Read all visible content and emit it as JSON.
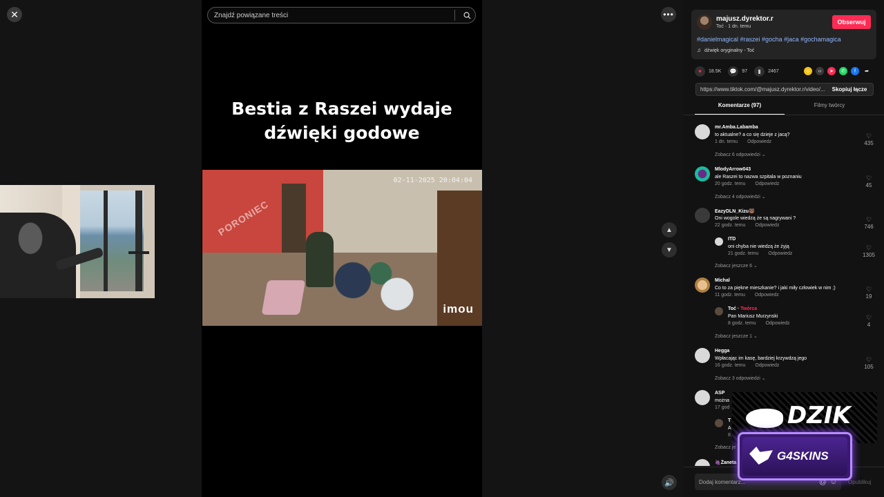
{
  "player": {
    "search_placeholder": "Znajdź powiązane treści",
    "caption": "Bestia z Raszei wydaje\ndźwięki godowe",
    "cctv_timestamp": "02-11-2025 20:04:04",
    "cctv_watermark": "PORONIEC",
    "cctv_logo": "imou"
  },
  "post": {
    "author": "majusz.dyrektor.r",
    "meta": "Toć · 1 dn. temu",
    "follow_label": "Obserwuj",
    "tags": "#danielmagical #raszei #gocha #jaca #gochamagica",
    "sound": "dźwięk oryginalny - Toć",
    "likes": "18.5K",
    "comments": "97",
    "saves": "2467",
    "link": "https://www.tiktok.com/@majusz.dyrektor.r/video/...",
    "copy_label": "Skopiuj łącze"
  },
  "tabs": {
    "comments": "Komentarze (97)",
    "creator_videos": "Filmy twórcy"
  },
  "comments": [
    {
      "name": "mr.Amba.Labamba",
      "text": "to aktualne? a co się dzieje z jacą?",
      "time": "1 dn. temu",
      "reply": "Odpowiedz",
      "likes": "435",
      "more": "Zobacz 6 odpowiedzi ⌄"
    },
    {
      "name": "MlodyArrow043",
      "text": "ale Raszei to nazwa szpitala w poznaniu",
      "time": "20 godz. temu",
      "reply": "Odpowiedz",
      "likes": "45",
      "more": "Zobacz 4 odpowiedzi ⌄"
    },
    {
      "name": "EazyDLN_Kizu🐻",
      "text": "Oni wogole wiedzą że są nagrywani ?",
      "time": "22 godz. temu",
      "reply": "Odpowiedz",
      "likes": "746"
    },
    {
      "name": "ITD",
      "text": "oni chyba nie wiedzą że żyją",
      "time": "21 godz. temu",
      "reply": "Odpowiedz",
      "likes": "1305",
      "more": "Zobacz jeszcze 6 ⌄"
    },
    {
      "name": "Michal",
      "text": "Co to za piękne mieszkanie? i jaki miły człowiek w nim ;)",
      "time": "11 godz. temu",
      "reply": "Odpowiedz",
      "likes": "19"
    },
    {
      "name": "Toć",
      "creator": "Twórca",
      "text": "Pan Mariusz Murzynski",
      "time": "8 godz. temu",
      "reply": "Odpowiedz",
      "likes": "4",
      "more": "Zobacz jeszcze 1 ⌄"
    },
    {
      "name": "Hegga",
      "text": "Wpłacając im kasę, bardziej krzywdzą jego",
      "time": "16 godz. temu",
      "reply": "Odpowiedz",
      "likes": "105",
      "more": "Zobacz 3 odpowiedzi ⌄"
    },
    {
      "name": "ASP",
      "text": "można",
      "time": "17 god",
      "reply": "",
      "likes": ""
    },
    {
      "name": "T",
      "text": "A",
      "time": "8",
      "reply": "",
      "likes": "",
      "more": "Zobacz je"
    },
    {
      "name": "🍇Żaneta",
      "text": "",
      "time": "",
      "reply": "",
      "likes": ""
    }
  ],
  "composer": {
    "placeholder": "Dodaj komentarz...",
    "post_label": "Opublikuj"
  },
  "ads": {
    "dzik": "DZIK",
    "g4skins": "G4SKINS"
  }
}
